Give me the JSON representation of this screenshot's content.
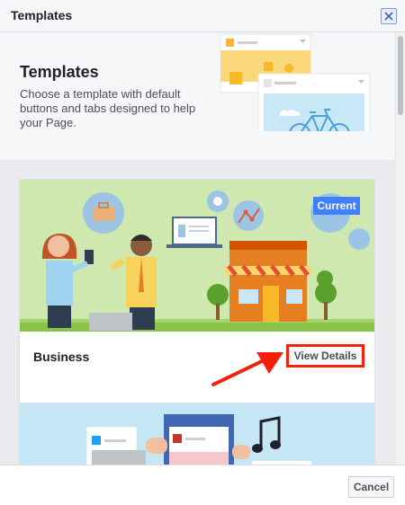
{
  "dialog": {
    "title": "Templates",
    "close_icon": "close-icon"
  },
  "intro": {
    "title": "Templates",
    "description": "Choose a template with default buttons and tabs designed to help your Page."
  },
  "templates": [
    {
      "name": "Business",
      "badge": "Current",
      "button_label": "View Details"
    }
  ],
  "footer": {
    "cancel_label": "Cancel"
  },
  "colors": {
    "accent_blue": "#4267b2",
    "highlight_red": "#f5200c"
  }
}
